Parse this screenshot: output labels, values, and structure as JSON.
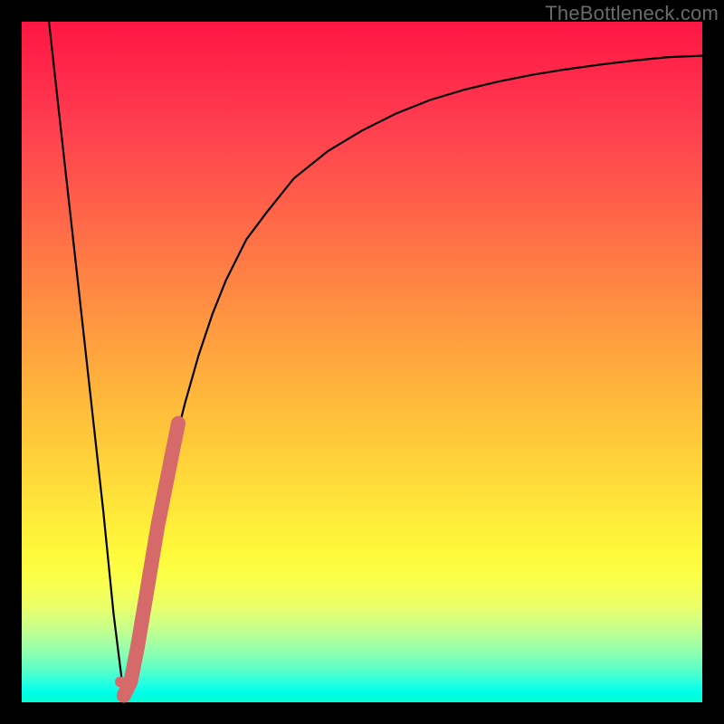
{
  "watermark": "TheBottleneck.com",
  "chart_data": {
    "type": "line",
    "title": "",
    "xlabel": "",
    "ylabel": "",
    "ylim": [
      0,
      100
    ],
    "xlim": [
      0,
      100
    ],
    "series": [
      {
        "name": "bottleneck-curve",
        "x": [
          4,
          6,
          8,
          10,
          12,
          13.5,
          14.5,
          15,
          16,
          17,
          18,
          20,
          22,
          24,
          26,
          28,
          30,
          33,
          36,
          40,
          45,
          50,
          55,
          60,
          65,
          70,
          75,
          80,
          85,
          90,
          95,
          100
        ],
        "values": [
          100,
          82,
          64,
          46,
          28,
          13,
          5,
          1,
          3,
          8,
          14,
          26,
          36,
          44,
          51,
          57,
          62,
          68,
          72,
          77,
          81,
          84,
          86.5,
          88.5,
          90,
          91.2,
          92.2,
          93,
          93.7,
          94.3,
          94.8,
          95
        ]
      }
    ],
    "highlight": {
      "name": "highlight-segment",
      "color": "#d66a6a",
      "x": [
        15,
        16,
        17,
        18,
        19,
        20,
        21,
        22,
        23
      ],
      "values": [
        1,
        3,
        8,
        14,
        20,
        26,
        31,
        36,
        41
      ]
    }
  }
}
